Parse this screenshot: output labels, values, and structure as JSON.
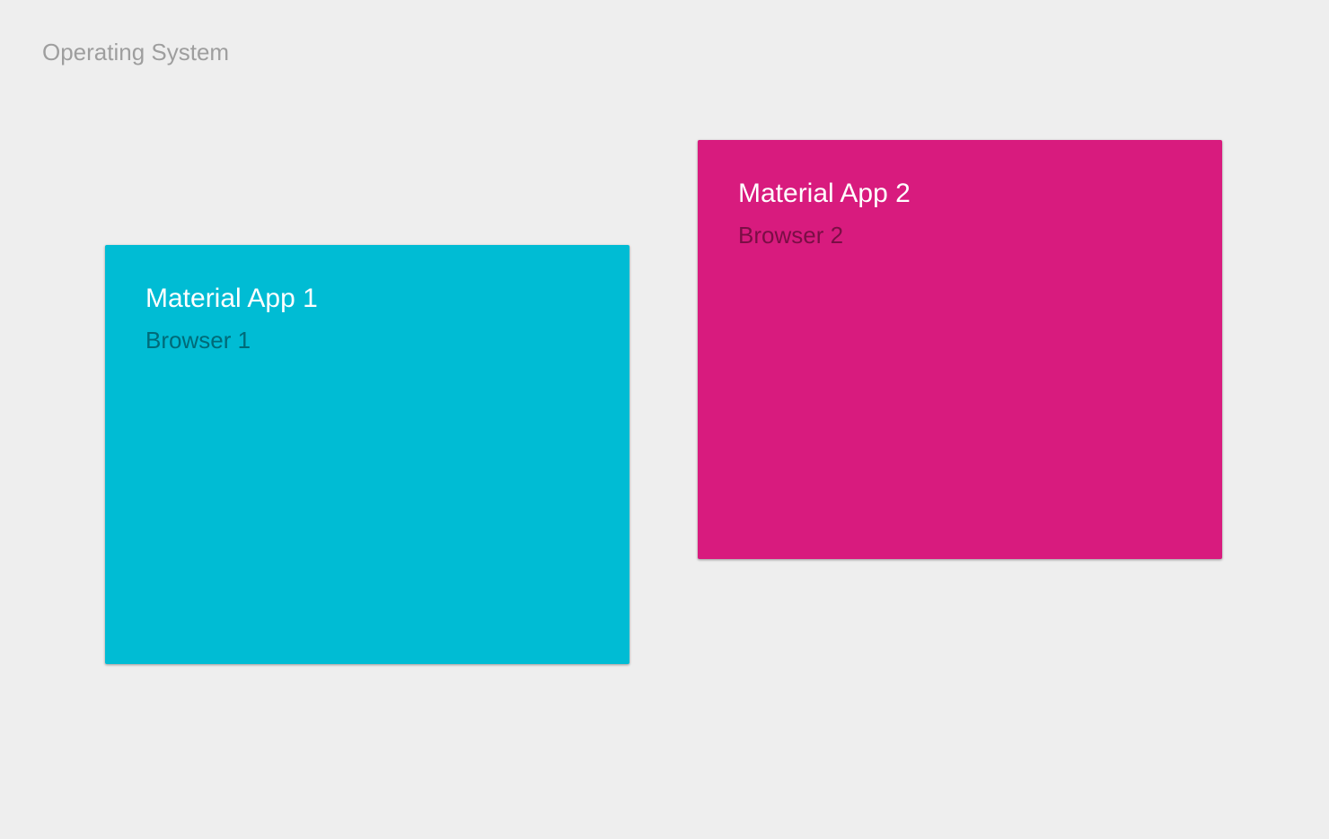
{
  "os": {
    "label": "Operating System",
    "label_color": "#9e9e9e",
    "background_color": "#eeeeee"
  },
  "apps": [
    {
      "title": "Material App 1",
      "subtitle": "Browser 1",
      "background_color": "#00bcd4",
      "subtitle_color": "#006a78"
    },
    {
      "title": "Material App 2",
      "subtitle": "Browser 2",
      "background_color": "#d81b7e",
      "subtitle_color": "#7a0e45"
    }
  ]
}
